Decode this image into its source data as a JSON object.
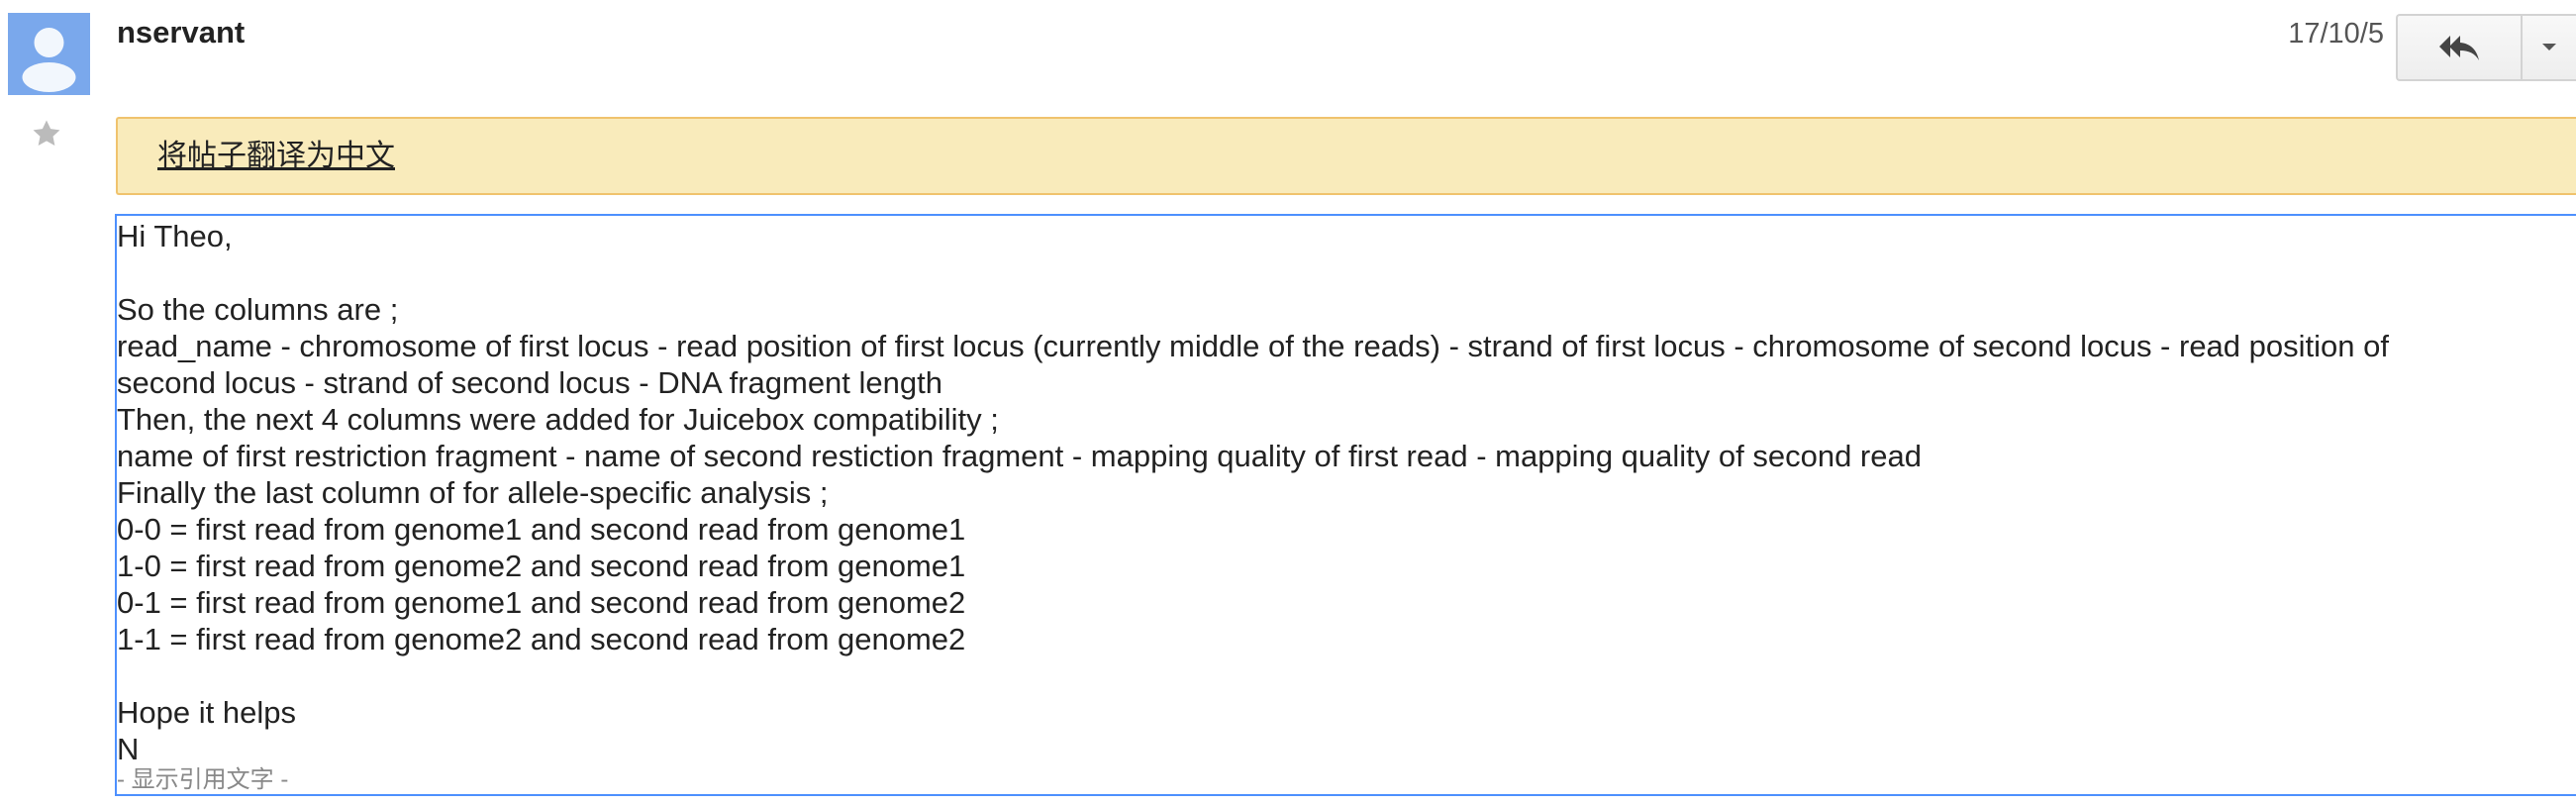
{
  "message": {
    "sender": "nservant",
    "date": "17/10/5",
    "avatar_icon": "default-person-avatar",
    "star_icon": "star-outline-icon",
    "reply_icon": "reply-all-icon",
    "more_icon": "dropdown-arrow-icon"
  },
  "translate_bar": {
    "link": "将帖子翻译为中文"
  },
  "body": {
    "lines": [
      "Hi Theo,",
      "",
      "So the columns are ;",
      "read_name - chromosome of first locus - read position of first locus (currently middle of the reads) - strand of first locus - chromosome of second locus - read position of",
      "second locus - strand of second locus - DNA fragment length",
      "Then, the next 4 columns were added for Juicebox compatibility ;",
      "name of first restriction fragment - name of second restiction fragment - mapping quality of first read - mapping quality of second read",
      "Finally the last column of for allele-specific analysis ;",
      "0-0 = first read from genome1 and second read from genome1",
      "1-0 = first read from genome2 and second read from genome1",
      "0-1 = first read from genome1 and second read from genome2",
      "1-1 = first read from genome2 and second read from genome2",
      "",
      "Hope it helps",
      "N"
    ],
    "show_quoted": "- 显示引用文字 -"
  },
  "colors": {
    "avatar_bg": "#7aa8ec",
    "translate_bg": "#f9ebbb",
    "translate_border": "#f0c36d",
    "body_border": "#4d90fe"
  }
}
